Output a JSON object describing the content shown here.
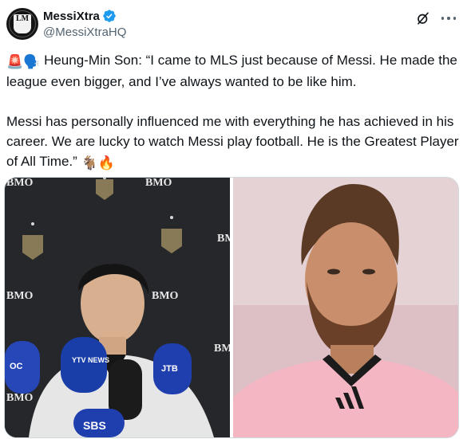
{
  "author": {
    "display_name": "MessiXtra",
    "handle": "@MessiXtraHQ",
    "avatar_text": "LM"
  },
  "post": {
    "paragraph1": {
      "emojis": [
        "🚨",
        "🗣️"
      ],
      "text": "Heung-Min Son: “I came to MLS just because of Messi. He made the league even bigger, and I’ve always wanted to be like him."
    },
    "paragraph2": {
      "text": "Messi has personally influenced me with everything he has achieved in his career. We are lucky to watch Messi play football. He is the Greatest Player of All Time.”",
      "emojis": [
        "🐐",
        "🔥"
      ]
    }
  },
  "media": {
    "left_photo": {
      "sponsor_text": [
        "BMO",
        "BMO",
        "BMO",
        "BMO",
        "BMO",
        "BMO",
        "BMO"
      ],
      "mic_labels": [
        "OC",
        "YTV NEWS",
        "JTB",
        "SBS"
      ]
    }
  },
  "colors": {
    "verified": "#1d9bf0",
    "text_primary": "#0f1419",
    "text_secondary": "#536471",
    "border": "#cfd9de",
    "inter_miami_pink": "#f4b6c2"
  },
  "icons": {
    "verified": "verified-badge-icon",
    "grok": "grok-icon",
    "more": "more-icon"
  }
}
